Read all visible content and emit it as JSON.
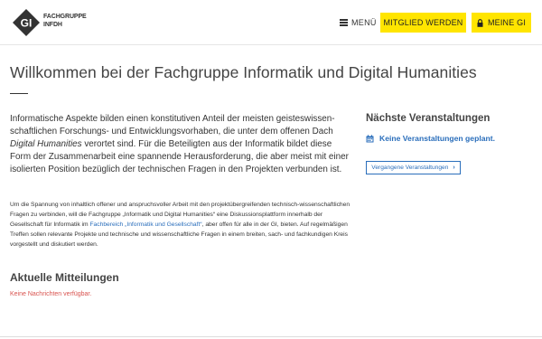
{
  "header": {
    "logo_line1": "FACHGRUPPE",
    "logo_line2": "INFDH",
    "menu_label": "MENÜ",
    "member_button": "MITGLIED WERDEN",
    "mygi_button": "MEINE GI"
  },
  "main": {
    "title": "Willkommen bei der Fachgruppe Informatik und Digital Humanities",
    "intro_part1": "Informatische Aspekte bilden einen konstitutiven Anteil der meisten geisteswissen­schaftlichen Forschungs- und Entwicklungsvorhaben, die unter dem offenen Dach ",
    "intro_em": "Digital Humanities",
    "intro_part2": " verortet sind. Für die Beteiligten aus der Informatik bildet diese Form der Zusammenarbeit eine spannende Herausforderung, die aber meist mit einer isolierten Position bezüglich der technischen Fragen in den Projekten ver­bunden ist.",
    "detail_part1": "Um die Spannung von inhaltlich offener und anspruchsvoller Arbeit mit den projektübergreifenden technisch-wissenschaftlichen Fragen zu verbinden, will die Fachgruppe „Informatik und Digital Humanities“ eine Diskussi­onsplattform innerhalb der Gesellschaft für Informatik im ",
    "detail_link": "Fachbereich „Informatik und Gesellschaft“",
    "detail_part2": ", aber offen für alle in der GI, bieten. Auf regelmäßigen Treffen sollen relevante Projekte und technische und wissenschaftli­che Fragen in einem breiten, sach- und fachkundigen Kreis vorgestellt und diskutiert werden.",
    "news_title": "Aktuelle Mitteilungen",
    "news_empty": "Keine Nachrichten verfügbar."
  },
  "sidebar": {
    "events_title": "Nächste Veranstaltungen",
    "events_none": "Keine Veranstaltungen geplant.",
    "past_button": "Vergangene Veranstaltungen"
  },
  "icons": {
    "logo": "gi-logo",
    "menu": "hamburger-icon",
    "lock": "lock-icon",
    "calendar": "calendar-icon",
    "chevron": "chevron-right-icon"
  },
  "colors": {
    "accent_yellow": "#ffe500",
    "link_blue": "#2a6ebb",
    "alert_red": "#d9534f"
  }
}
